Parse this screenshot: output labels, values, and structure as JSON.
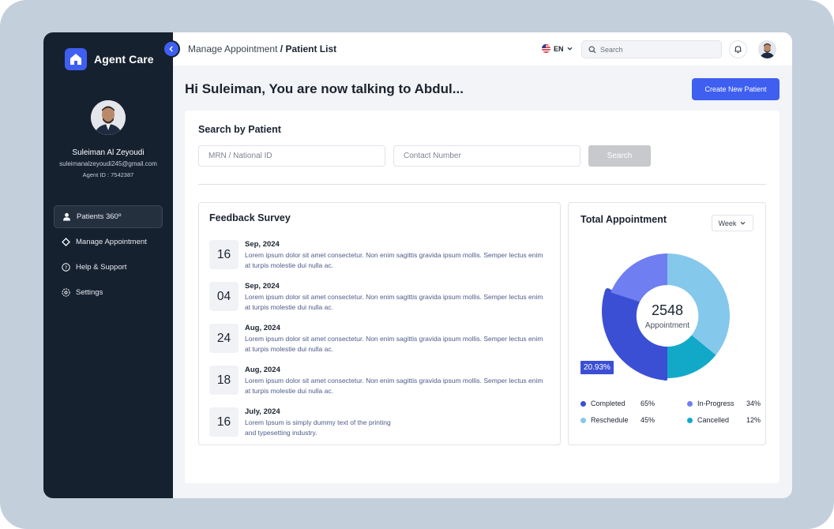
{
  "sidebar": {
    "brand": "Agent Care",
    "user": {
      "name": "Suleiman Al Zeyoudi",
      "email": "suleimanalzeyoudi245@gmail.com",
      "agent_id": "Agent ID : 7542387"
    },
    "nav": [
      {
        "label": "Patients 360º",
        "icon": "person-icon",
        "active": true
      },
      {
        "label": "Manage Appointment",
        "icon": "diamond-icon",
        "active": false
      },
      {
        "label": "Help  & Support",
        "icon": "help-circle-icon",
        "active": false
      },
      {
        "label": "Settings",
        "icon": "settings-icon",
        "active": false
      }
    ]
  },
  "topbar": {
    "breadcrumb_parent": "Manage Appointment",
    "breadcrumb_sep": " / ",
    "breadcrumb_current": "Patient List",
    "language": "EN",
    "search_placeholder": "Search"
  },
  "main": {
    "greeting": "Hi Suleiman, You are now talking to Abdul...",
    "create_button": "Create New Patient",
    "search_by_patient": {
      "title": "Search by Patient",
      "mrn_placeholder": "MRN / National ID",
      "contact_placeholder": "Contact Number",
      "search_button": "Search"
    },
    "feedback": {
      "title": "Feedback Survey",
      "items": [
        {
          "day": "16",
          "date": "Sep, 2024",
          "text": "Lorem ipsum dolor sit amet consectetur. Non enim sagittis gravida ipsum mollis. Semper lectus enim at turpis molestie dui nulla ac."
        },
        {
          "day": "04",
          "date": "Sep, 2024",
          "text": "Lorem ipsum dolor sit amet consectetur. Non enim sagittis gravida ipsum mollis. Semper lectus enim at turpis molestie dui nulla ac."
        },
        {
          "day": "24",
          "date": "Aug, 2024",
          "text": "Lorem ipsum dolor sit amet consectetur. Non enim sagittis gravida ipsum mollis. Semper lectus enim at turpis molestie dui nulla ac."
        },
        {
          "day": "18",
          "date": "Aug, 2024",
          "text": "Lorem ipsum dolor sit amet consectetur. Non enim sagittis gravida ipsum mollis. Semper lectus enim at turpis molestie dui nulla ac."
        },
        {
          "day": "16",
          "date": "July, 2024",
          "text": "Lorem Ipsum is simply dummy text of the printing and typesetting industry."
        }
      ]
    },
    "appointments": {
      "title": "Total Appointment",
      "period": "Week",
      "total": "2548",
      "total_label": "Appointment",
      "highlight": "20.93%",
      "legend": [
        {
          "name": "Completed",
          "value": "65%",
          "color": "#3b4fd4"
        },
        {
          "name": "In-Progress",
          "value": "34%",
          "color": "#6f7ef0"
        },
        {
          "name": "Reschedule",
          "value": "45%",
          "color": "#84c8eb"
        },
        {
          "name": "Cancelled",
          "value": "12%",
          "color": "#12a9c9"
        }
      ]
    }
  },
  "colors": {
    "accent": "#3f5ff0",
    "sidebar_bg": "#162130",
    "page_bg": "#f3f4f7"
  }
}
